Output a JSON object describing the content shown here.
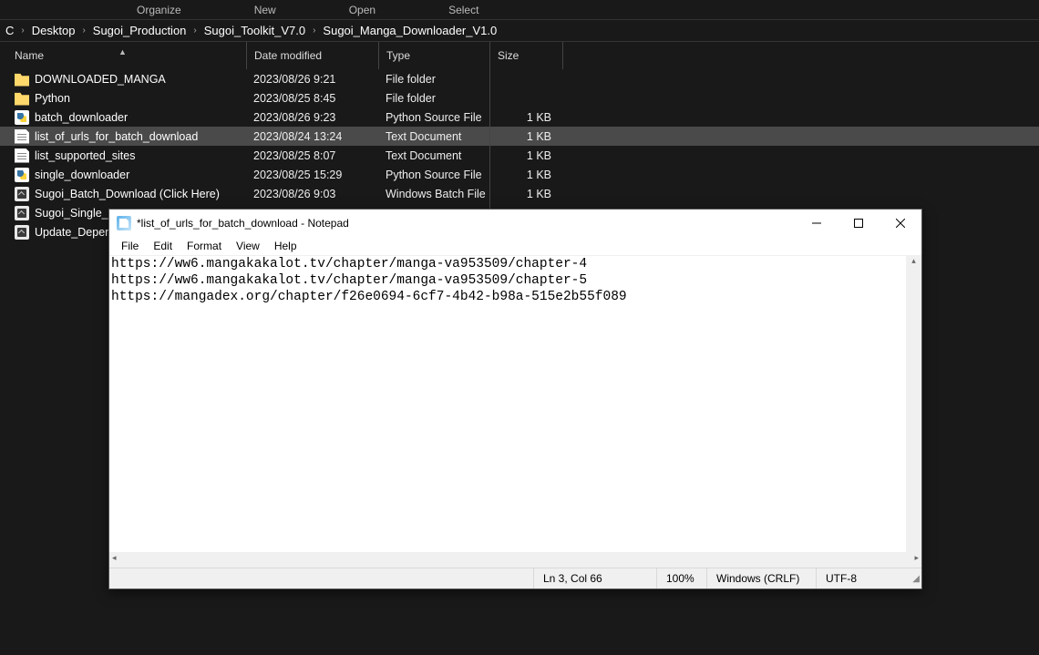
{
  "toolbar": {
    "organize": "Organize",
    "new": "New",
    "open": "Open",
    "select": "Select"
  },
  "breadcrumb": [
    "C",
    "Desktop",
    "Sugoi_Production",
    "Sugoi_Toolkit_V7.0",
    "Sugoi_Manga_Downloader_V1.0"
  ],
  "headers": {
    "name": "Name",
    "date": "Date modified",
    "type": "Type",
    "size": "Size"
  },
  "files": [
    {
      "icon": "folder",
      "name": "DOWNLOADED_MANGA",
      "date": "2023/08/26 9:21",
      "type": "File folder",
      "size": "",
      "selected": false
    },
    {
      "icon": "folder",
      "name": "Python",
      "date": "2023/08/25 8:45",
      "type": "File folder",
      "size": "",
      "selected": false
    },
    {
      "icon": "py",
      "name": "batch_downloader",
      "date": "2023/08/26 9:23",
      "type": "Python Source File",
      "size": "1 KB",
      "selected": false
    },
    {
      "icon": "txt",
      "name": "list_of_urls_for_batch_download",
      "date": "2023/08/24 13:24",
      "type": "Text Document",
      "size": "1 KB",
      "selected": true
    },
    {
      "icon": "txt",
      "name": "list_supported_sites",
      "date": "2023/08/25 8:07",
      "type": "Text Document",
      "size": "1 KB",
      "selected": false
    },
    {
      "icon": "py",
      "name": "single_downloader",
      "date": "2023/08/25 15:29",
      "type": "Python Source File",
      "size": "1 KB",
      "selected": false
    },
    {
      "icon": "bat",
      "name": "Sugoi_Batch_Download (Click Here)",
      "date": "2023/08/26 9:03",
      "type": "Windows Batch File",
      "size": "1 KB",
      "selected": false
    },
    {
      "icon": "bat",
      "name": "Sugoi_Single_Do",
      "date": "",
      "type": "",
      "size": "",
      "selected": false
    },
    {
      "icon": "bat",
      "name": "Update_Depend",
      "date": "",
      "type": "",
      "size": "",
      "selected": false
    }
  ],
  "notepad": {
    "title": "*list_of_urls_for_batch_download - Notepad",
    "menu": [
      "File",
      "Edit",
      "Format",
      "View",
      "Help"
    ],
    "content": "https://ww6.mangakakalot.tv/chapter/manga-va953509/chapter-4\nhttps://ww6.mangakakalot.tv/chapter/manga-va953509/chapter-5\nhttps://mangadex.org/chapter/f26e0694-6cf7-4b42-b98a-515e2b55f089",
    "status": {
      "position": "Ln 3, Col 66",
      "zoom": "100%",
      "lineending": "Windows (CRLF)",
      "encoding": "UTF-8"
    }
  }
}
